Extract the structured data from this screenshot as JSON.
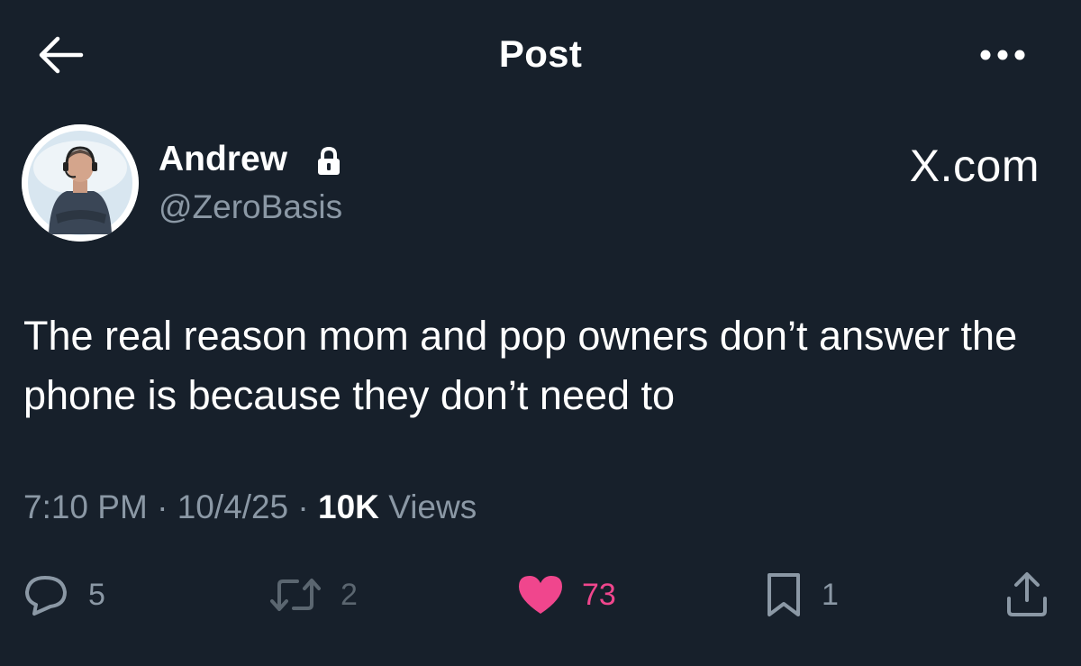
{
  "header": {
    "title": "Post",
    "back_icon": "arrow-left-icon",
    "more_icon": "more-horizontal-icon"
  },
  "author": {
    "display_name": "Andrew",
    "handle": "@ZeroBasis",
    "protected_icon": "lock-icon"
  },
  "watermark": "X.com",
  "post": {
    "text": "The real reason mom and pop owners don’t answer the phone is because they don’t need to"
  },
  "meta": {
    "time": "7:10 PM",
    "separator": " · ",
    "date": "10/4/25",
    "views_count": "10K",
    "views_label": " Views"
  },
  "actions": {
    "replies": "5",
    "reposts": "2",
    "likes": "73",
    "bookmarks": "1"
  },
  "colors": {
    "background": "#17202b",
    "text": "#ffffff",
    "secondary": "#8b98a5",
    "like": "#f0468d"
  }
}
